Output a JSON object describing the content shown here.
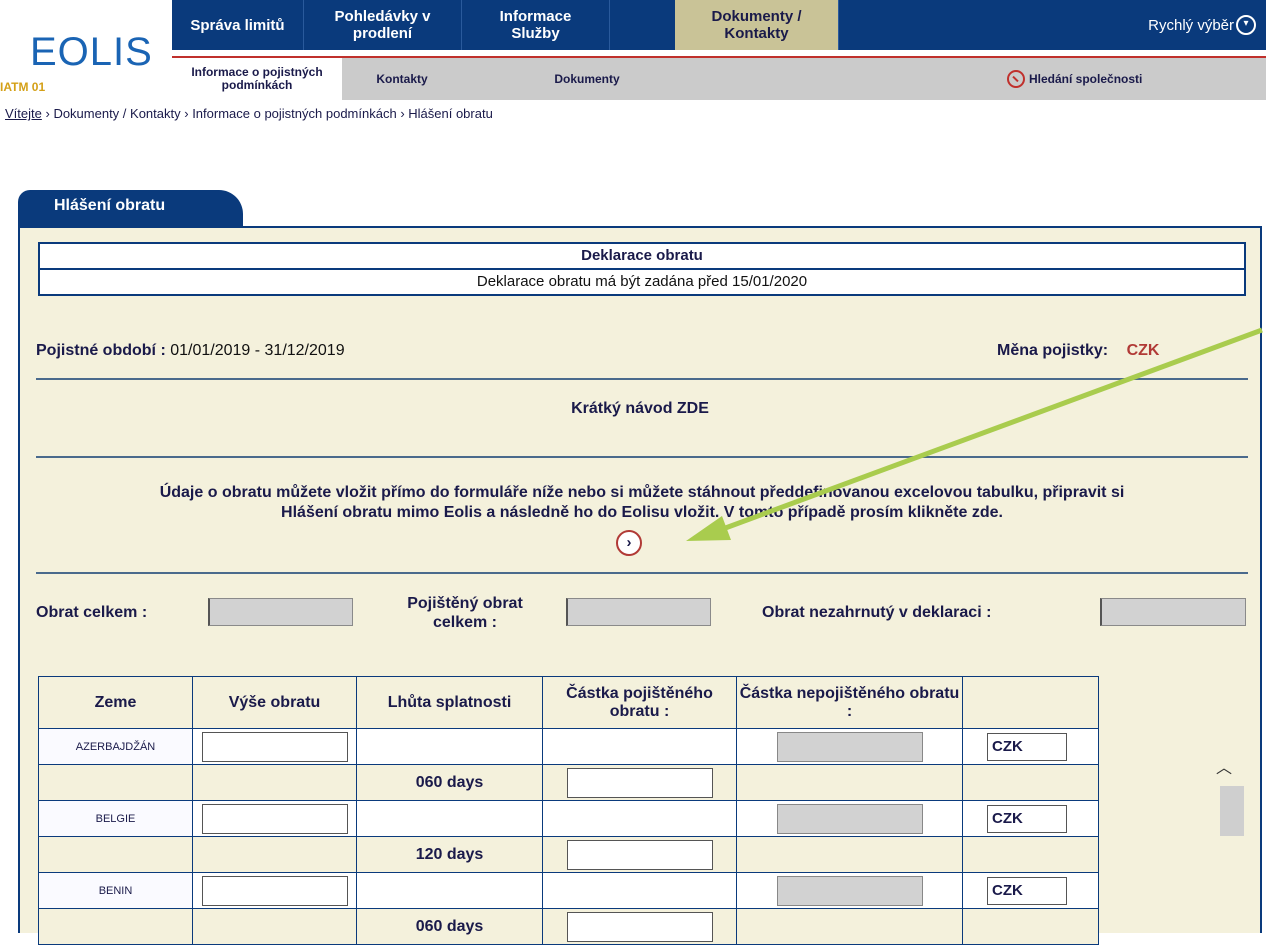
{
  "brand": {
    "logo": "EOLIS",
    "sub": "IATM 01"
  },
  "topnav": {
    "items": [
      "Správa limitů",
      "Pohledávky v prodlení",
      "Informace Služby",
      "Dokumenty / Kontakty"
    ],
    "active_index": 3,
    "quick": "Rychlý výběr"
  },
  "subnav": {
    "items": [
      "Informace o pojistných podmínkách",
      "Kontakty",
      "Dokumenty"
    ],
    "active_index": 0,
    "search": "Hledání společnosti"
  },
  "breadcrumb": [
    "Vítejte",
    "Dokumenty / Kontakty",
    "Informace o pojistných podmínkách",
    "Hlášení obratu"
  ],
  "panel": {
    "tab": "Hlášení obratu",
    "decl_title": "Deklarace obratu",
    "decl_note": "Deklarace obratu má být zadána před 15/01/2020",
    "period_label": "Pojistné období :",
    "period_value": "01/01/2019 - 31/12/2019",
    "currency_label": "Měna pojistky:",
    "currency_value": "CZK",
    "guide": "Krátký návod ZDE",
    "info_line1": "Údaje o obratu můžete vložit přímo do formuláře níže nebo si můžete stáhnout předdefinovanou excelovou tabulku, připravit si",
    "info_line2": "Hlášení obratu mimo Eolis a následně ho do Eolisu vložit. V tomto případě prosím klikněte zde.",
    "totals": {
      "total_label": "Obrat celkem :",
      "insured_label": "Pojištěný obrat celkem :",
      "excluded_label": "Obrat nezahrnutý v deklaraci :"
    }
  },
  "table": {
    "headers": [
      "Zeme",
      "Výše obratu",
      "Lhůta splatnosti",
      "Částka pojištěného obratu :",
      "Částka nepojištěného obratu :",
      ""
    ],
    "rows": [
      {
        "country": "AZERBAJDŽÁN",
        "days": "060 days",
        "currency": "CZK"
      },
      {
        "country": "BELGIE",
        "days": "120 days",
        "currency": "CZK"
      },
      {
        "country": "BENIN",
        "days": "060 days",
        "currency": "CZK"
      }
    ]
  },
  "colors": {
    "navy": "#0a3a7c",
    "panel_bg": "#f4f1dc",
    "active_tab": "#c9c397",
    "accent_red": "#b13a36",
    "annotation_arrow": "#a9cc4e"
  }
}
